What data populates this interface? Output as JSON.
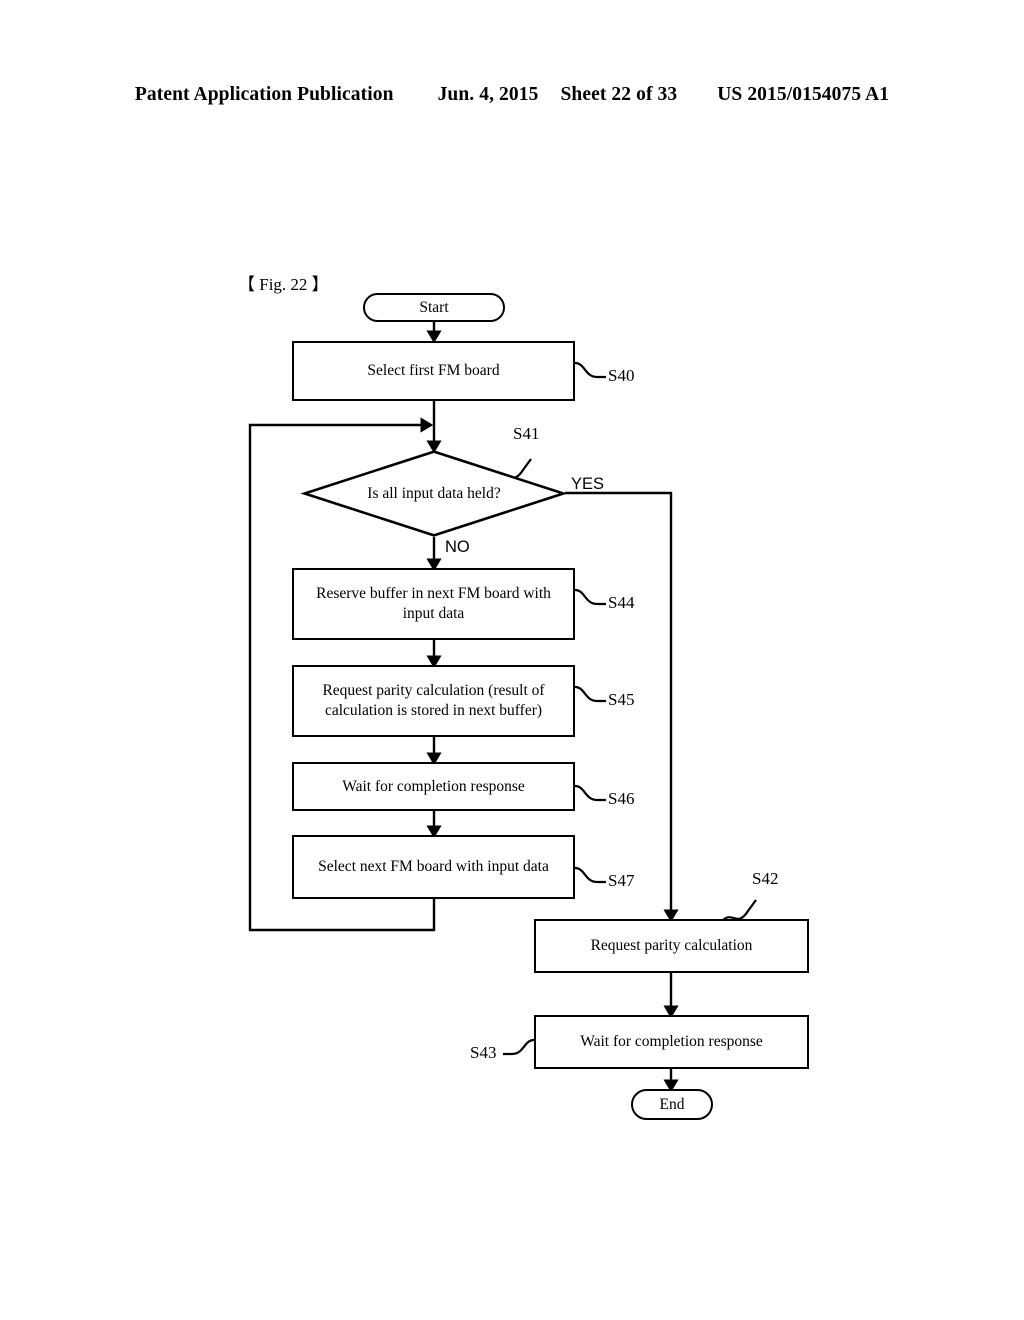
{
  "header": {
    "publication": "Patent Application Publication",
    "date": "Jun. 4, 2015",
    "sheet": "Sheet 22 of 33",
    "number": "US 2015/0154075 A1"
  },
  "figure": {
    "label": "【 Fig. 22 】"
  },
  "flowchart": {
    "type": "flowchart",
    "nodes": {
      "start": {
        "label": "Start",
        "shape": "terminator"
      },
      "s40": {
        "label": "Select first FM board",
        "shape": "process",
        "ref": "S40"
      },
      "s41": {
        "label": "Is all input data held?",
        "shape": "decision",
        "ref": "S41"
      },
      "s44": {
        "label": "Reserve buffer in next FM board with input data",
        "shape": "process",
        "ref": "S44"
      },
      "s45": {
        "label": "Request parity calculation (result of calculation is stored in next buffer)",
        "shape": "process",
        "ref": "S45"
      },
      "s46": {
        "label": "Wait for completion response",
        "shape": "process",
        "ref": "S46"
      },
      "s47": {
        "label": "Select next FM board with input data",
        "shape": "process",
        "ref": "S47"
      },
      "s42": {
        "label": "Request parity calculation",
        "shape": "process",
        "ref": "S42"
      },
      "s43": {
        "label": "Wait for completion response",
        "shape": "process",
        "ref": "S43"
      },
      "end": {
        "label": "End",
        "shape": "terminator"
      }
    },
    "branches": {
      "yes": "YES",
      "no": "NO"
    },
    "lines": [
      {
        "from": "start",
        "to": "s40"
      },
      {
        "from": "s40",
        "to": "s41"
      },
      {
        "from": "s41",
        "to": "s44",
        "label": "NO"
      },
      {
        "from": "s41",
        "to": "s42",
        "label": "YES"
      },
      {
        "from": "s44",
        "to": "s45"
      },
      {
        "from": "s45",
        "to": "s46"
      },
      {
        "from": "s46",
        "to": "s47"
      },
      {
        "from": "s47",
        "to": "s41",
        "kind": "loop-back"
      },
      {
        "from": "s42",
        "to": "s43"
      },
      {
        "from": "s43",
        "to": "end"
      }
    ]
  },
  "colors": {
    "ink": "#000000",
    "paper": "#ffffff"
  }
}
